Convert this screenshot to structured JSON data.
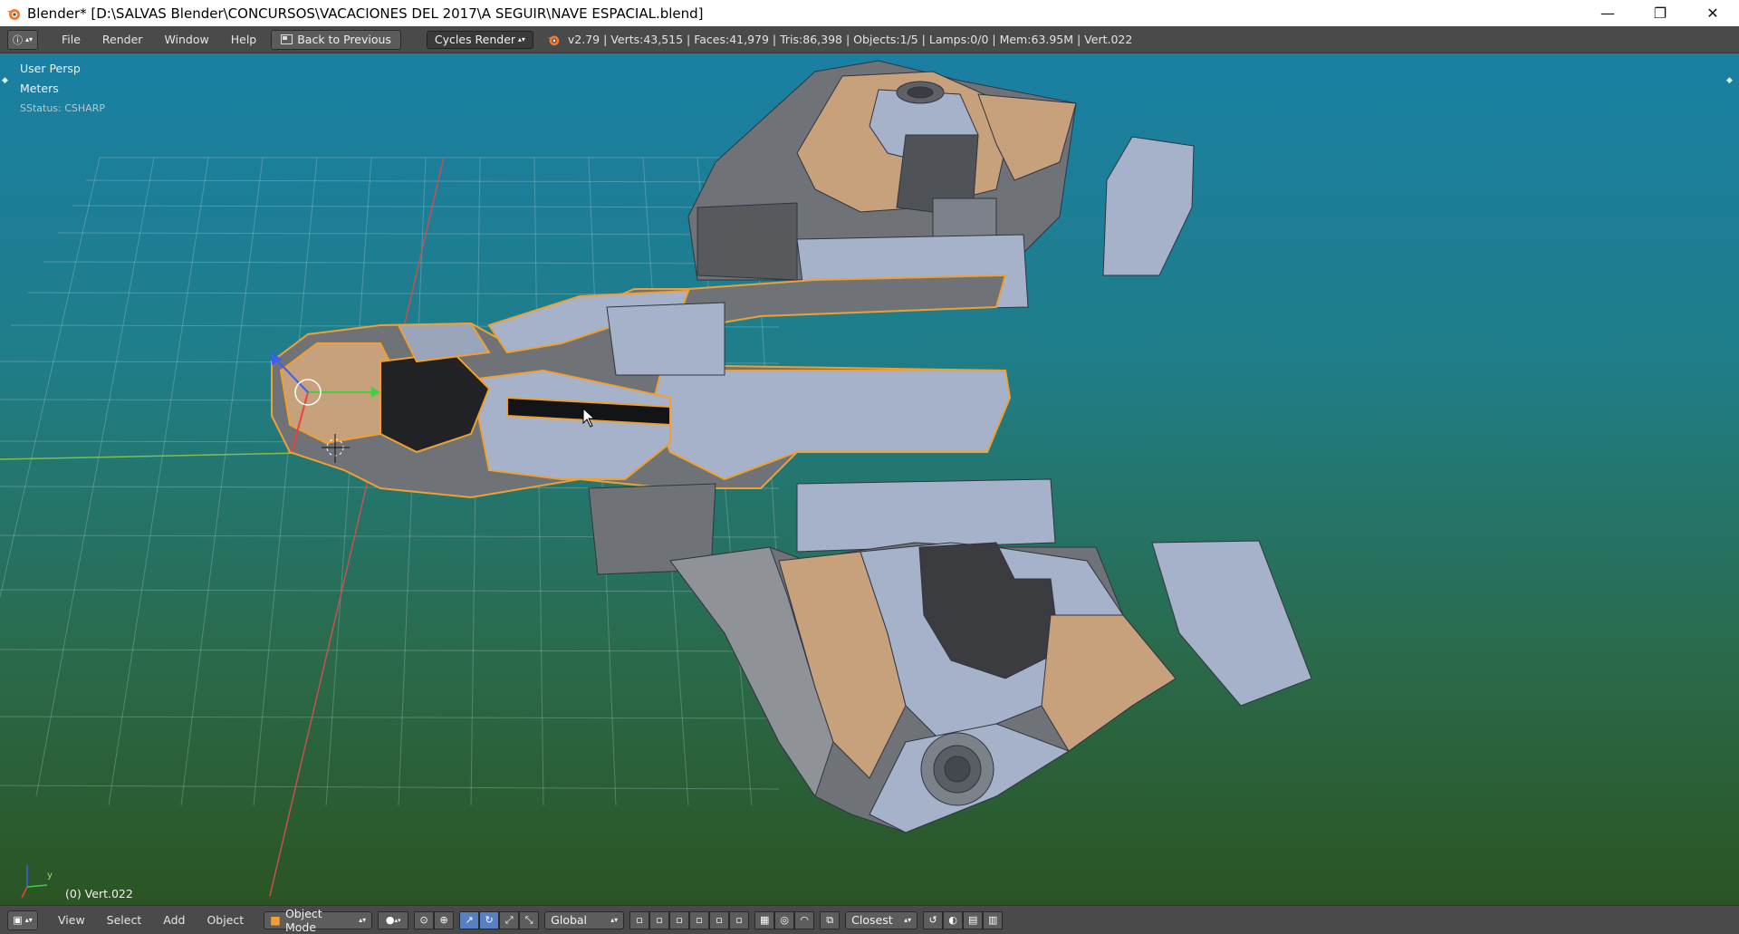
{
  "window": {
    "title": "Blender* [D:\\SALVAS Blender\\CONCURSOS\\VACACIONES DEL 2017\\A SEGUIR\\NAVE ESPACIAL.blend]",
    "minimize_icon": "minimize-icon",
    "maximize_icon": "restore-icon",
    "close_icon": "close-icon",
    "minimize_glyph": "—",
    "restore_glyph": "❐",
    "close_glyph": "✕"
  },
  "info_header": {
    "editor_type_glyph": "ⓘ",
    "menus": [
      "File",
      "Render",
      "Window",
      "Help"
    ],
    "back_button": "Back to Previous",
    "render_engine": "Cycles Render",
    "stats": "v2.79 | Verts:43,515 | Faces:41,979 | Tris:86,398 | Objects:1/5 | Lamps:0/0 | Mem:63.95M | Vert.022"
  },
  "viewport": {
    "view_name": "User Persp",
    "units": "Meters",
    "status": "SStatus: CSHARP",
    "object_label": "(0) Vert.022",
    "axis_x": "",
    "axis_y": "y",
    "background_top": "#1a7fa3",
    "background_bottom": "#2b5423",
    "selection_outline": "#f0a030"
  },
  "bottom_header": {
    "menus": [
      "View",
      "Select",
      "Add",
      "Object"
    ],
    "mode": "Object Mode",
    "pivot": "Global",
    "snap_target": "Closest"
  }
}
